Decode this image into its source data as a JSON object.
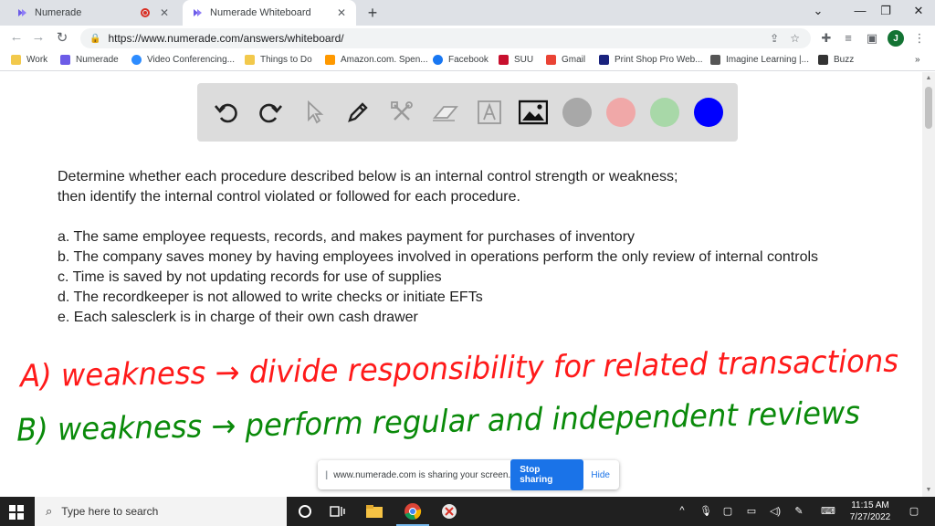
{
  "browser": {
    "tabs": [
      {
        "title": "Numerade"
      },
      {
        "title": "Numerade Whiteboard"
      }
    ],
    "url": "https://www.numerade.com/answers/whiteboard/",
    "profile_initial": "J",
    "bookmarks": [
      {
        "label": "Work",
        "color": "#f2c94c"
      },
      {
        "label": "Numerade",
        "color": "#6c5ce7"
      },
      {
        "label": "Video Conferencing...",
        "color": "#2d8cff"
      },
      {
        "label": "Things to Do",
        "color": "#f2c94c"
      },
      {
        "label": "Amazon.com. Spen...",
        "color": "#ff9900"
      },
      {
        "label": "Facebook",
        "color": "#1877f2"
      },
      {
        "label": "SUU",
        "color": "#c8102e"
      },
      {
        "label": "Gmail",
        "color": "#ea4335"
      },
      {
        "label": "Print Shop Pro Web...",
        "color": "#1a237e"
      },
      {
        "label": "Imagine Learning |...",
        "color": "#555555"
      },
      {
        "label": "Buzz",
        "color": "#333333"
      }
    ],
    "bookmarks_overflow": "»"
  },
  "whiteboard": {
    "tools": [
      {
        "name": "undo-icon"
      },
      {
        "name": "redo-icon"
      },
      {
        "name": "pointer-icon"
      },
      {
        "name": "pen-icon"
      },
      {
        "name": "tools-icon"
      },
      {
        "name": "eraser-icon"
      },
      {
        "name": "text-icon"
      },
      {
        "name": "image-icon"
      }
    ],
    "colors": [
      "#a8a8a8",
      "#f0a8a8",
      "#a8d8a8",
      "#0000ff"
    ],
    "question_lines": [
      "Determine whether each procedure described below is an internal control strength or weakness;",
      "then identify the internal control violated or followed for each procedure."
    ],
    "items": [
      "a. The same employee requests, records, and makes payment for purchases of inventory",
      "b. The company saves money by having employees involved in operations perform the only review of internal controls",
      "c. Time is saved by not updating records for use of supplies",
      "d. The recordkeeper is not allowed to write checks or initiate EFTs",
      "e. Each salesclerk is in charge of their own cash drawer"
    ],
    "handwriting": [
      {
        "text": "A) weakness → divide responsibility for related transactions",
        "color": "#ff1a1a"
      },
      {
        "text": "B) weakness → perform regular and independent reviews",
        "color": "#0a8a0a"
      }
    ]
  },
  "sharing": {
    "message": "www.numerade.com is sharing your screen.",
    "stop_label": "Stop sharing",
    "hide_label": "Hide"
  },
  "taskbar": {
    "search_placeholder": "Type here to search",
    "time": "11:15 AM",
    "date": "7/27/2022"
  }
}
